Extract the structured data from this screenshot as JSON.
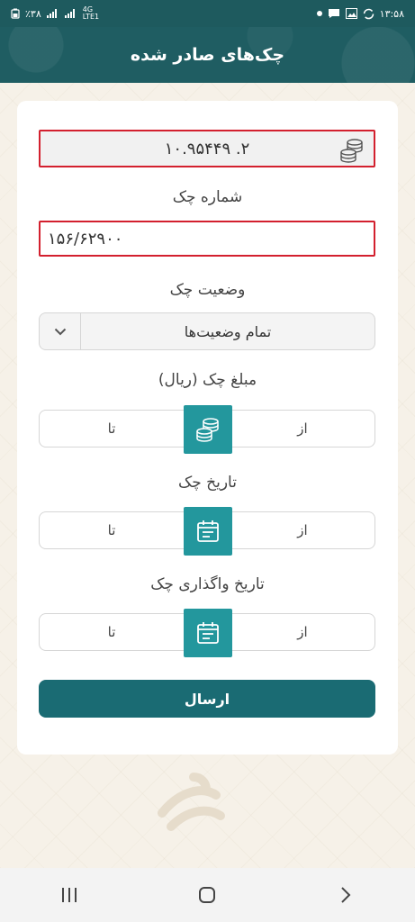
{
  "status_bar": {
    "left_text": "٪۳۸",
    "network": "4G",
    "network_sub": "LTE1",
    "time": "۱۳:۵۸"
  },
  "header": {
    "title": "چک‌های صادر شده"
  },
  "form": {
    "account_number": "۱۰.۹۵۴۴۹   .۲",
    "check_number_label": "شماره چک",
    "check_number_value": "۱۵۶/۶۲۹۰۰",
    "status_label": "وضعیت چک",
    "status_value": "تمام وضعیت‌ها",
    "amount_label": "مبلغ چک (ریال)",
    "amount_from": "از",
    "amount_to": "تا",
    "date_label": "تاریخ چک",
    "date_from": "از",
    "date_to": "تا",
    "transfer_date_label": "تاریخ واگذاری چک",
    "transfer_from": "از",
    "transfer_to": "تا",
    "submit_label": "ارسال"
  },
  "icons": {
    "coins": "coins-icon",
    "calendar": "calendar-icon",
    "chevron": "chevron-down-icon"
  },
  "colors": {
    "header_bg": "#1f5d62",
    "accent": "#23979d",
    "submit_bg": "#1a6b73",
    "highlight_border": "#d3202e"
  }
}
